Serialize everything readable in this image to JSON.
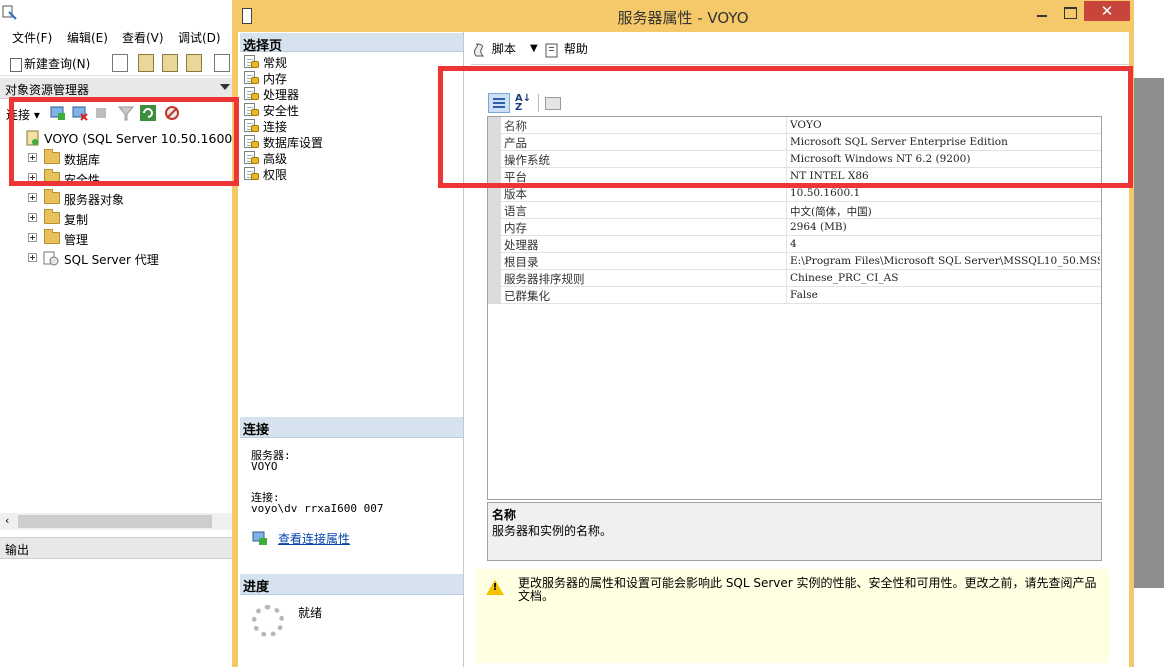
{
  "background_window": {
    "menu": [
      "文件(F)",
      "编辑(E)",
      "查看(V)",
      "调试(D)"
    ],
    "new_query_label": "新建查询(N)",
    "object_explorer": {
      "title": "对象资源管理器",
      "connect_label": "连接",
      "server_node": "VOYO (SQL Server 10.50.1600 -",
      "nodes": [
        "数据库",
        "安全性",
        "服务器对象",
        "复制",
        "管理",
        "SQL Server 代理"
      ]
    },
    "output_title": "输出"
  },
  "dialog": {
    "title": "服务器属性 - VOYO",
    "close_glyph": "✕",
    "select_page": {
      "header": "选择页",
      "items": [
        "常规",
        "内存",
        "处理器",
        "安全性",
        "连接",
        "数据库设置",
        "高级",
        "权限"
      ]
    },
    "connection": {
      "header": "连接",
      "server_label": "服务器:",
      "server_value": "VOYO",
      "connection_label": "连接:",
      "connection_value": "voyo\\dv rrxaI600 007",
      "view_link": "查看连接属性"
    },
    "progress": {
      "header": "进度",
      "status": "就绪"
    },
    "toolbar": {
      "script_label": "脚本",
      "help_label": "帮助"
    },
    "grid_toolbar": {
      "az_top": "A↓",
      "az_bottom": "Z"
    },
    "properties": [
      {
        "name": "名称",
        "value": "VOYO"
      },
      {
        "name": "产品",
        "value": "Microsoft SQL Server Enterprise Edition"
      },
      {
        "name": "操作系统",
        "value": "Microsoft Windows NT 6.2 (9200)"
      },
      {
        "name": "平台",
        "value": "NT INTEL X86"
      },
      {
        "name": "版本",
        "value": "10.50.1600.1"
      },
      {
        "name": "语言",
        "value": "中文(简体，中国)"
      },
      {
        "name": "内存",
        "value": "2964 (MB)"
      },
      {
        "name": "处理器",
        "value": "4"
      },
      {
        "name": "根目录",
        "value": "E:\\Program Files\\Microsoft SQL Server\\MSSQL10_50.MSS"
      },
      {
        "name": "服务器排序规则",
        "value": "Chinese_PRC_CI_AS"
      },
      {
        "name": "已群集化",
        "value": "False"
      }
    ],
    "description": {
      "title": "名称",
      "text": "服务器和实例的名称。"
    },
    "warning": {
      "glyph": "!",
      "text": "更改服务器的属性和设置可能会影响此 SQL Server 实例的性能、安全性和可用性。更改之前，请先查阅产品文档。"
    }
  },
  "colors": {
    "dialog_frame": "#f5c96a",
    "annotation_red": "#ee3535",
    "section_header": "#d6e3ef",
    "warning_bg": "#ffffe1"
  }
}
